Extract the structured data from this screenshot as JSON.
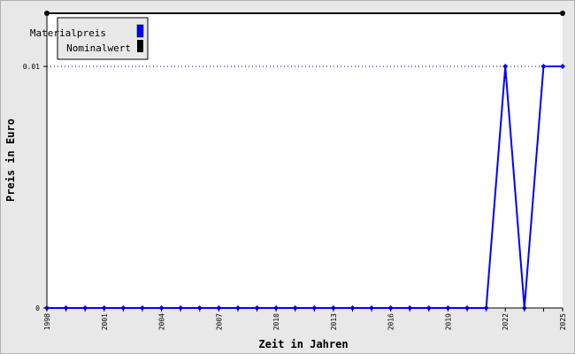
{
  "chart_data": {
    "type": "line",
    "title": "",
    "xlabel": "Zeit in Jahren",
    "ylabel": "Preis in Euro",
    "x": [
      1998,
      1999,
      2000,
      2001,
      2002,
      2003,
      2004,
      2005,
      2006,
      2007,
      2008,
      2009,
      2010,
      2011,
      2012,
      2013,
      2014,
      2015,
      2016,
      2017,
      2018,
      2019,
      2020,
      2021,
      2022,
      2023,
      2024,
      2025
    ],
    "x_tick_labels": [
      "1998",
      "2001",
      "2004",
      "2007",
      "2010",
      "2013",
      "2016",
      "2019",
      "2022",
      "2025"
    ],
    "xlim": [
      1998,
      2025
    ],
    "y_tick_labels": [
      "0",
      "0.01"
    ],
    "y_ticks": [
      0,
      0.01
    ],
    "ylim": [
      0,
      0.0122
    ],
    "series": [
      {
        "name": "Materialpreis",
        "color": "#0000ff",
        "values": [
          0,
          0,
          0,
          0,
          0,
          0,
          0,
          0,
          0,
          0,
          0,
          0,
          0,
          0,
          0,
          0,
          0,
          0,
          0,
          0,
          0,
          0,
          0,
          0,
          0.01,
          0,
          0.01,
          0.01
        ]
      },
      {
        "name": "Nominalwert",
        "color": "#000000",
        "values": [
          0.0122,
          0.0122,
          0.0122,
          0.0122,
          0.0122,
          0.0122,
          0.0122,
          0.0122,
          0.0122,
          0.0122,
          0.0122,
          0.0122,
          0.0122,
          0.0122,
          0.0122,
          0.0122,
          0.0122,
          0.0122,
          0.0122,
          0.0122,
          0.0122,
          0.0122,
          0.0122,
          0.0122,
          0.0122,
          0.0122,
          0.0122,
          0.0122
        ]
      }
    ],
    "legend_position": "top-left",
    "grid": "dotted line at 0.01"
  }
}
